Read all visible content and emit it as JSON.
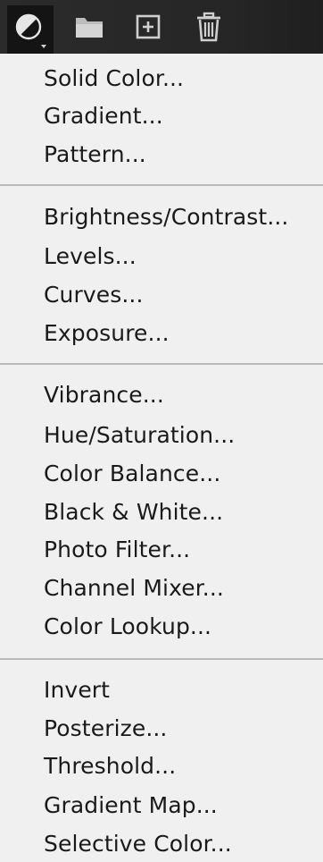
{
  "toolbar": {
    "buttons": [
      {
        "name": "adjustment-layer-icon"
      },
      {
        "name": "folder-icon"
      },
      {
        "name": "new-layer-icon"
      },
      {
        "name": "trash-icon"
      }
    ]
  },
  "menu": {
    "groups": [
      [
        "Solid Color...",
        "Gradient...",
        "Pattern..."
      ],
      [
        "Brightness/Contrast...",
        "Levels...",
        "Curves...",
        "Exposure..."
      ],
      [
        "Vibrance...",
        "Hue/Saturation...",
        "Color Balance...",
        "Black & White...",
        "Photo Filter...",
        "Channel Mixer...",
        "Color Lookup..."
      ],
      [
        "Invert",
        "Posterize...",
        "Threshold...",
        "Gradient Map...",
        "Selective Color..."
      ]
    ]
  }
}
